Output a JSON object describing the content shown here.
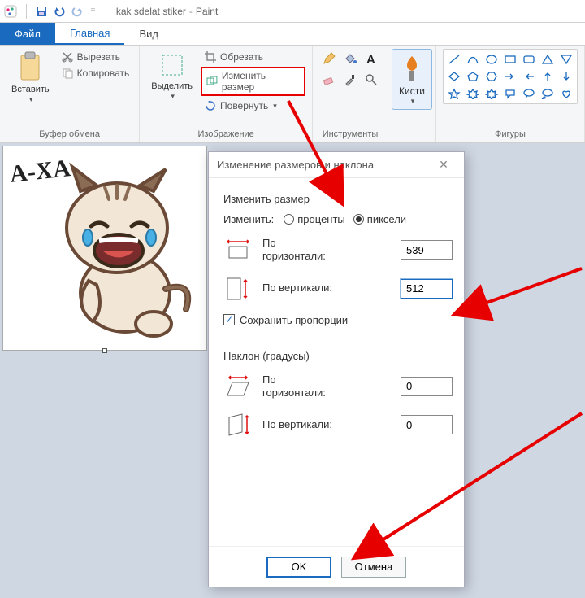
{
  "app": {
    "title_doc": "kak sdelat stiker",
    "title_app": "Paint"
  },
  "tabs": {
    "file": "Файл",
    "home": "Главная",
    "view": "Вид"
  },
  "ribbon": {
    "clipboard": {
      "paste": "Вставить",
      "cut": "Вырезать",
      "copy": "Копировать",
      "group": "Буфер обмена"
    },
    "image": {
      "select": "Выделить",
      "crop": "Обрезать",
      "resize": "Изменить размер",
      "rotate": "Повернуть",
      "group": "Изображение"
    },
    "tools": {
      "group": "Инструменты"
    },
    "brushes": {
      "label": "Кисти"
    },
    "shapes": {
      "group": "Фигуры"
    }
  },
  "canvas": {
    "sticker_text": "A-XA"
  },
  "dialog": {
    "title": "Изменение размеров и наклона",
    "resize_section": "Изменить размер",
    "change_label": "Изменить:",
    "percent": "проценты",
    "pixels": "пиксели",
    "horizontal": "По\nгоризонтали:",
    "horizontal_single": "По горизонтали:",
    "vertical": "По вертикали:",
    "h_value": "539",
    "v_value": "512",
    "keep_ratio": "Сохранить пропорции",
    "skew_section": "Наклон (градусы)",
    "skew_h": "0",
    "skew_v": "0",
    "ok": "OK",
    "cancel": "Отмена"
  }
}
